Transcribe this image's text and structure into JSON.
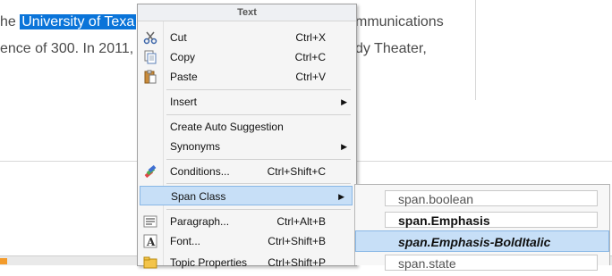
{
  "document": {
    "line1_before": "he ",
    "line1_selected": "University of Texa",
    "line1_after": "mmunications",
    "line2_before": "ence of 300. In 2011,",
    "line2_after": "dy Theater,"
  },
  "menu": {
    "header": "Text",
    "items": [
      {
        "label": "Cut",
        "shortcut": "Ctrl+X",
        "icon": "scissors-icon"
      },
      {
        "label": "Copy",
        "shortcut": "Ctrl+C",
        "icon": "copy-icon"
      },
      {
        "label": "Paste",
        "shortcut": "Ctrl+V",
        "icon": "paste-icon"
      },
      {
        "label": "Insert",
        "submenu": true
      },
      {
        "label": "Create Auto Suggestion"
      },
      {
        "label": "Synonyms",
        "submenu": true
      },
      {
        "label": "Conditions...",
        "shortcut": "Ctrl+Shift+C",
        "icon": "conditions-icon"
      },
      {
        "label": "Span Class",
        "submenu": true,
        "highlighted": true
      },
      {
        "label": "Paragraph...",
        "shortcut": "Ctrl+Alt+B",
        "icon": "paragraph-icon"
      },
      {
        "label": "Font...",
        "shortcut": "Ctrl+Shift+B",
        "icon": "font-icon"
      },
      {
        "label": "Topic Properties",
        "shortcut": "Ctrl+Shift+P",
        "icon": "topic-properties-icon"
      }
    ]
  },
  "submenu": {
    "items": [
      {
        "label": "span.boolean"
      },
      {
        "label": "span.Emphasis"
      },
      {
        "label": "span.Emphasis-BoldItalic",
        "highlighted": true
      },
      {
        "label": "span.state"
      }
    ]
  },
  "colors": {
    "selection": "#0a74d9",
    "highlight": "#c7dff7",
    "highlight_border": "#88b7e6"
  }
}
